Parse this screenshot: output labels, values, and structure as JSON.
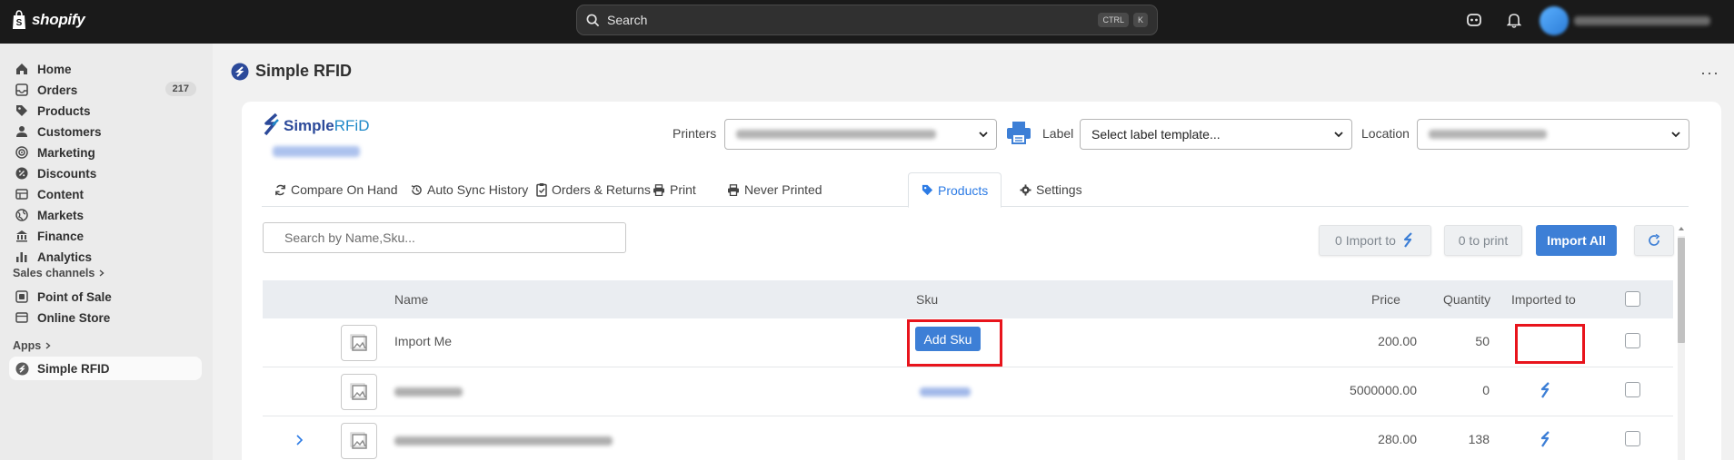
{
  "topbar": {
    "logo_text": "shopify",
    "search": {
      "label": "Search",
      "shortcut_ctrl": "CTRL",
      "shortcut_key": "K"
    },
    "icons": [
      "store-icon",
      "bell-icon"
    ]
  },
  "sidebar": {
    "items": [
      {
        "label": "Home",
        "icon": "home-icon"
      },
      {
        "label": "Orders",
        "icon": "inbox-icon",
        "badge": "217"
      },
      {
        "label": "Products",
        "icon": "tag-icon"
      },
      {
        "label": "Customers",
        "icon": "person-icon"
      },
      {
        "label": "Marketing",
        "icon": "target-icon"
      },
      {
        "label": "Discounts",
        "icon": "discount-icon"
      },
      {
        "label": "Content",
        "icon": "content-icon"
      },
      {
        "label": "Markets",
        "icon": "globe-icon"
      },
      {
        "label": "Finance",
        "icon": "bank-icon"
      },
      {
        "label": "Analytics",
        "icon": "chart-icon"
      }
    ],
    "sales_channels": {
      "title": "Sales channels",
      "items": [
        {
          "label": "Point of Sale",
          "icon": "pos-icon"
        },
        {
          "label": "Online Store",
          "icon": "store-icon"
        }
      ]
    },
    "apps": {
      "title": "Apps",
      "items": [
        {
          "label": "Simple RFID",
          "icon": "simple-rfid-icon",
          "active": true
        }
      ]
    }
  },
  "app": {
    "title": "Simple RFID",
    "more": "···",
    "logo": {
      "brand_bold": "Simple",
      "brand_light": "RFiD"
    },
    "printers_label": "Printers",
    "label_label": "Label",
    "label_select_value": "Select label template...",
    "location_label": "Location",
    "tabs": [
      {
        "label": "Compare On Hand",
        "icon": "sync-icon"
      },
      {
        "label": "Auto Sync History",
        "icon": "history-icon"
      },
      {
        "label": "Orders & Returns",
        "icon": "clipboard-icon"
      },
      {
        "label": "Print",
        "icon": "printer-icon"
      },
      {
        "label": "Never Printed",
        "icon": "printer-icon"
      },
      {
        "label": "Products",
        "icon": "tag-icon",
        "active": true
      },
      {
        "label": "Settings",
        "icon": "gear-icon"
      }
    ],
    "search_placeholder": "Search by Name,Sku...",
    "toolbar": {
      "import_to": "0 Import to",
      "to_print": "0 to print",
      "import_all": "Import All"
    },
    "table": {
      "columns": [
        "Name",
        "Sku",
        "Price",
        "Quantity",
        "Imported to"
      ],
      "rows": [
        {
          "name": "Import Me",
          "sku_button": "Add Sku",
          "price": "200.00",
          "quantity": "50"
        },
        {
          "name": "",
          "sku": "",
          "price": "5000000.00",
          "quantity": "0"
        },
        {
          "name": "",
          "sku": "",
          "price": "280.00",
          "quantity": "138"
        }
      ]
    }
  },
  "colors": {
    "accent": "#3d7fd6",
    "highlight": "#e8141c",
    "topbar": "#1a1a1a"
  }
}
